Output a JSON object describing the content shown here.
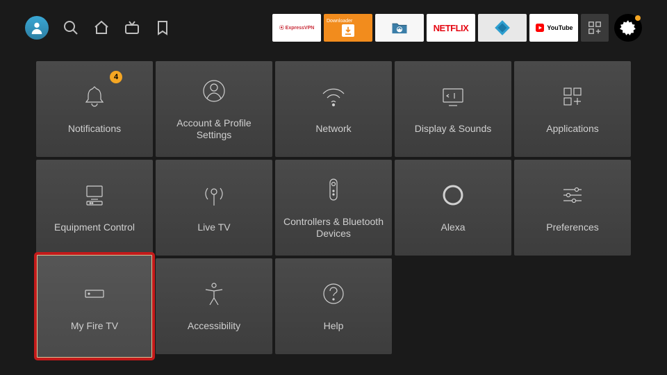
{
  "notifications_badge": "4",
  "apps": {
    "expressvpn": "ExpressVPN",
    "downloader": "Downloader",
    "netflix": "NETFLIX",
    "youtube": "YouTube"
  },
  "tiles": [
    {
      "id": "notifications",
      "label": "Notifications"
    },
    {
      "id": "account",
      "label": "Account & Profile Settings"
    },
    {
      "id": "network",
      "label": "Network"
    },
    {
      "id": "display",
      "label": "Display & Sounds"
    },
    {
      "id": "applications",
      "label": "Applications"
    },
    {
      "id": "equipment",
      "label": "Equipment Control"
    },
    {
      "id": "livetv",
      "label": "Live TV"
    },
    {
      "id": "controllers",
      "label": "Controllers & Bluetooth Devices"
    },
    {
      "id": "alexa",
      "label": "Alexa"
    },
    {
      "id": "preferences",
      "label": "Preferences"
    },
    {
      "id": "myfiretv",
      "label": "My Fire TV"
    },
    {
      "id": "accessibility",
      "label": "Accessibility"
    },
    {
      "id": "help",
      "label": "Help"
    }
  ],
  "selected_tile": "myfiretv"
}
